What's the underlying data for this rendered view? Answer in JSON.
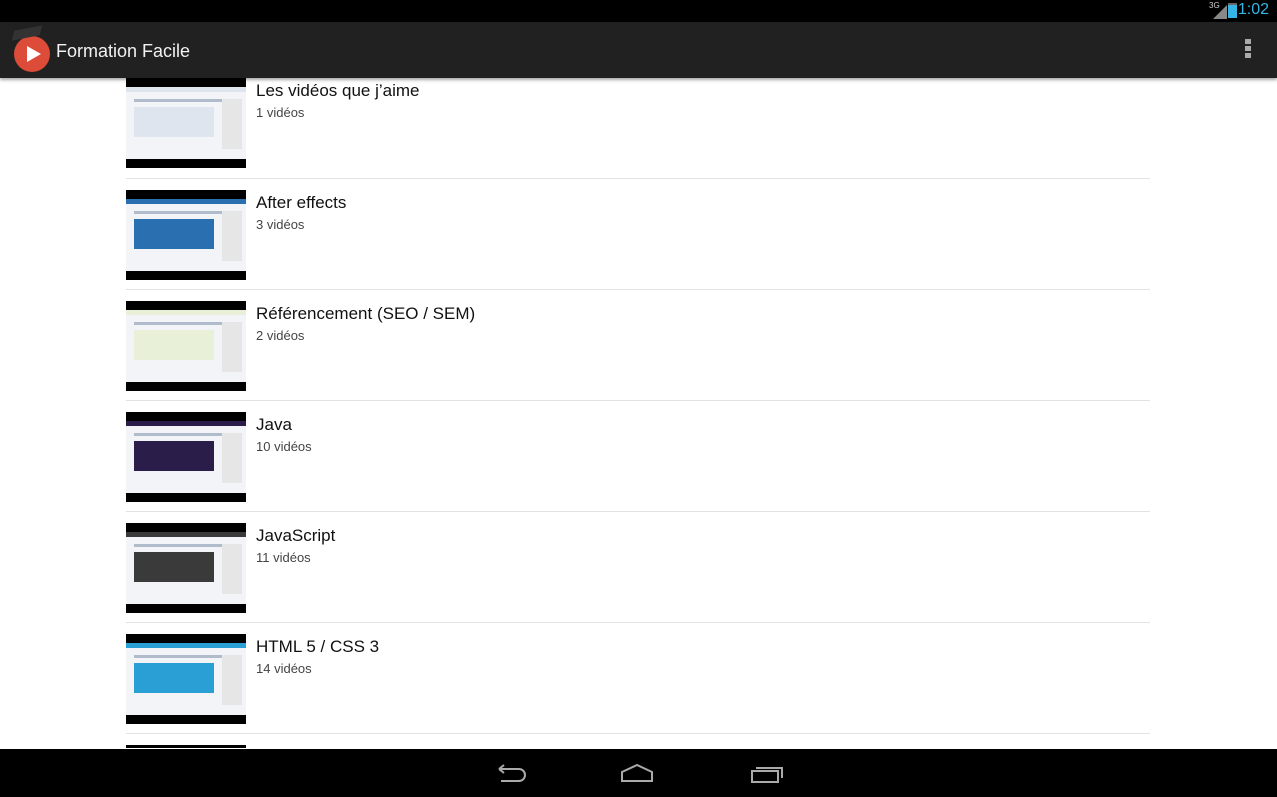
{
  "status_bar": {
    "network": "3G",
    "time": "1:02",
    "icons": [
      "signal-icon",
      "battery-charging-icon"
    ]
  },
  "action_bar": {
    "title": "Formation Facile",
    "icons": [
      "app-logo-icon",
      "overflow-menu-icon"
    ]
  },
  "playlists": [
    {
      "title": "Les vidéos que j’aime",
      "count": "1 vidéos",
      "thumb_color": "#dfe5ee"
    },
    {
      "title": "After effects",
      "count": "3 vidéos",
      "thumb_color": "#2a6fb0"
    },
    {
      "title": "Référencement (SEO / SEM)",
      "count": "2 vidéos",
      "thumb_color": "#e8f0d8"
    },
    {
      "title": "Java",
      "count": "10 vidéos",
      "thumb_color": "#2b1d4a"
    },
    {
      "title": "JavaScript",
      "count": "11 vidéos",
      "thumb_color": "#3a3a3a"
    },
    {
      "title": "HTML 5 / CSS 3",
      "count": "14 vidéos",
      "thumb_color": "#2a9fd6"
    },
    {
      "title": "",
      "count": "",
      "thumb_color": "#dfe5ee"
    }
  ],
  "nav_bar": {
    "icons": [
      "back-icon",
      "home-icon",
      "recent-apps-icon"
    ]
  }
}
